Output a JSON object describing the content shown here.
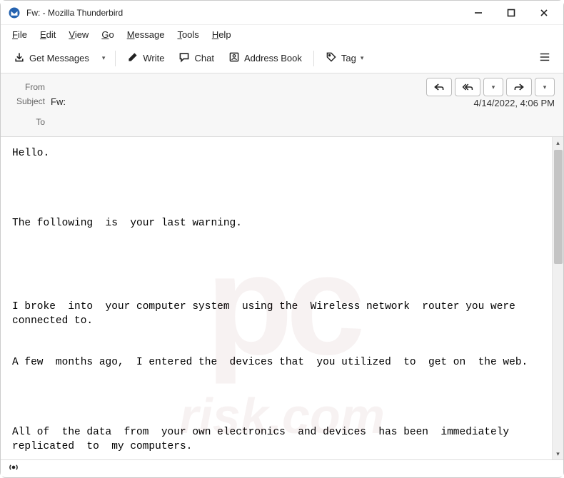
{
  "window": {
    "title": "Fw: - Mozilla Thunderbird"
  },
  "menubar": {
    "items": [
      {
        "label": "File",
        "accel": "F"
      },
      {
        "label": "Edit",
        "accel": "E"
      },
      {
        "label": "View",
        "accel": "V"
      },
      {
        "label": "Go",
        "accel": "G"
      },
      {
        "label": "Message",
        "accel": "M"
      },
      {
        "label": "Tools",
        "accel": "T"
      },
      {
        "label": "Help",
        "accel": "H"
      }
    ]
  },
  "toolbar": {
    "get_messages": "Get Messages",
    "write": "Write",
    "chat": "Chat",
    "address_book": "Address Book",
    "tag": "Tag"
  },
  "header": {
    "from_label": "From",
    "from_value": "",
    "subject_label": "Subject",
    "subject_value": "Fw:",
    "to_label": "To",
    "to_value": "",
    "datetime": "4/14/2022, 4:06 PM"
  },
  "body": {
    "text": "Hello.\n\n\n\n\nThe following  is  your last warning.\n\n\n\n\n\nI broke  into  your computer system  using the  Wireless network  router you were connected to.\n\n\nA few  months ago,  I entered the  devices that  you utilized  to  get on  the web.\n\n\n\n\nAll of  the data  from  your own electronics  and devices  has been  immediately replicated  to  my computers."
  }
}
